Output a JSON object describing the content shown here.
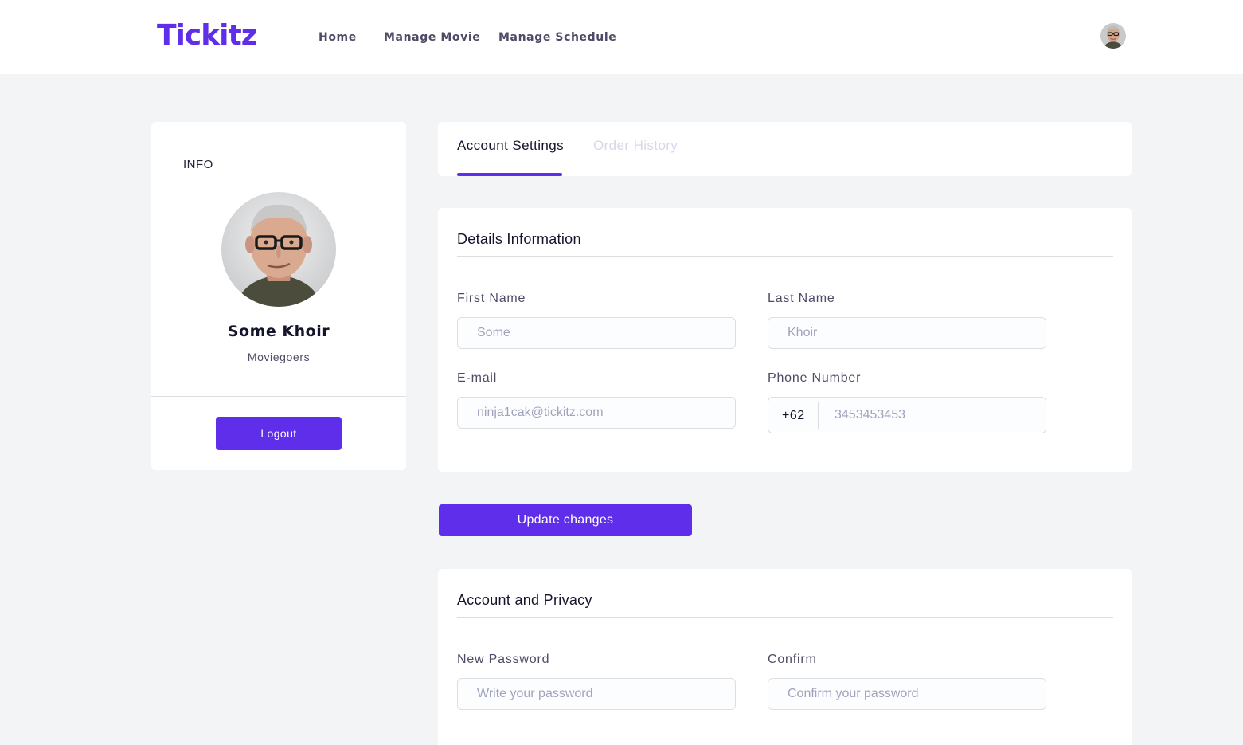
{
  "brand": {
    "logo_text": "Tickitz",
    "accent_color": "#5f2eea"
  },
  "nav": {
    "links": [
      "Home",
      "Manage Movie",
      "Manage Schedule"
    ],
    "avatar_icon": "user-avatar"
  },
  "profile": {
    "section_title": "INFO",
    "name": "Some Khoir",
    "role": "Moviegoers",
    "photo_icon": "profile-photo",
    "logout_label": "Logout"
  },
  "tabs": {
    "items": [
      {
        "label": "Account Settings",
        "active": true
      },
      {
        "label": "Order History",
        "active": false
      }
    ]
  },
  "details": {
    "title": "Details Information",
    "first_name": {
      "label": "First Name",
      "placeholder": "Some",
      "value": ""
    },
    "last_name": {
      "label": "Last Name",
      "placeholder": "Khoir",
      "value": ""
    },
    "email": {
      "label": "E-mail",
      "placeholder": "ninja1cak@tickitz.com",
      "value": ""
    },
    "phone": {
      "label": "Phone Number",
      "code": "+62",
      "placeholder": "3453453453",
      "value": ""
    }
  },
  "update_label": "Update changes",
  "privacy": {
    "title": "Account and Privacy",
    "new_password": {
      "label": "New Password",
      "placeholder": "Write your password"
    },
    "confirm": {
      "label": "Confirm",
      "placeholder": "Confirm your password"
    }
  }
}
